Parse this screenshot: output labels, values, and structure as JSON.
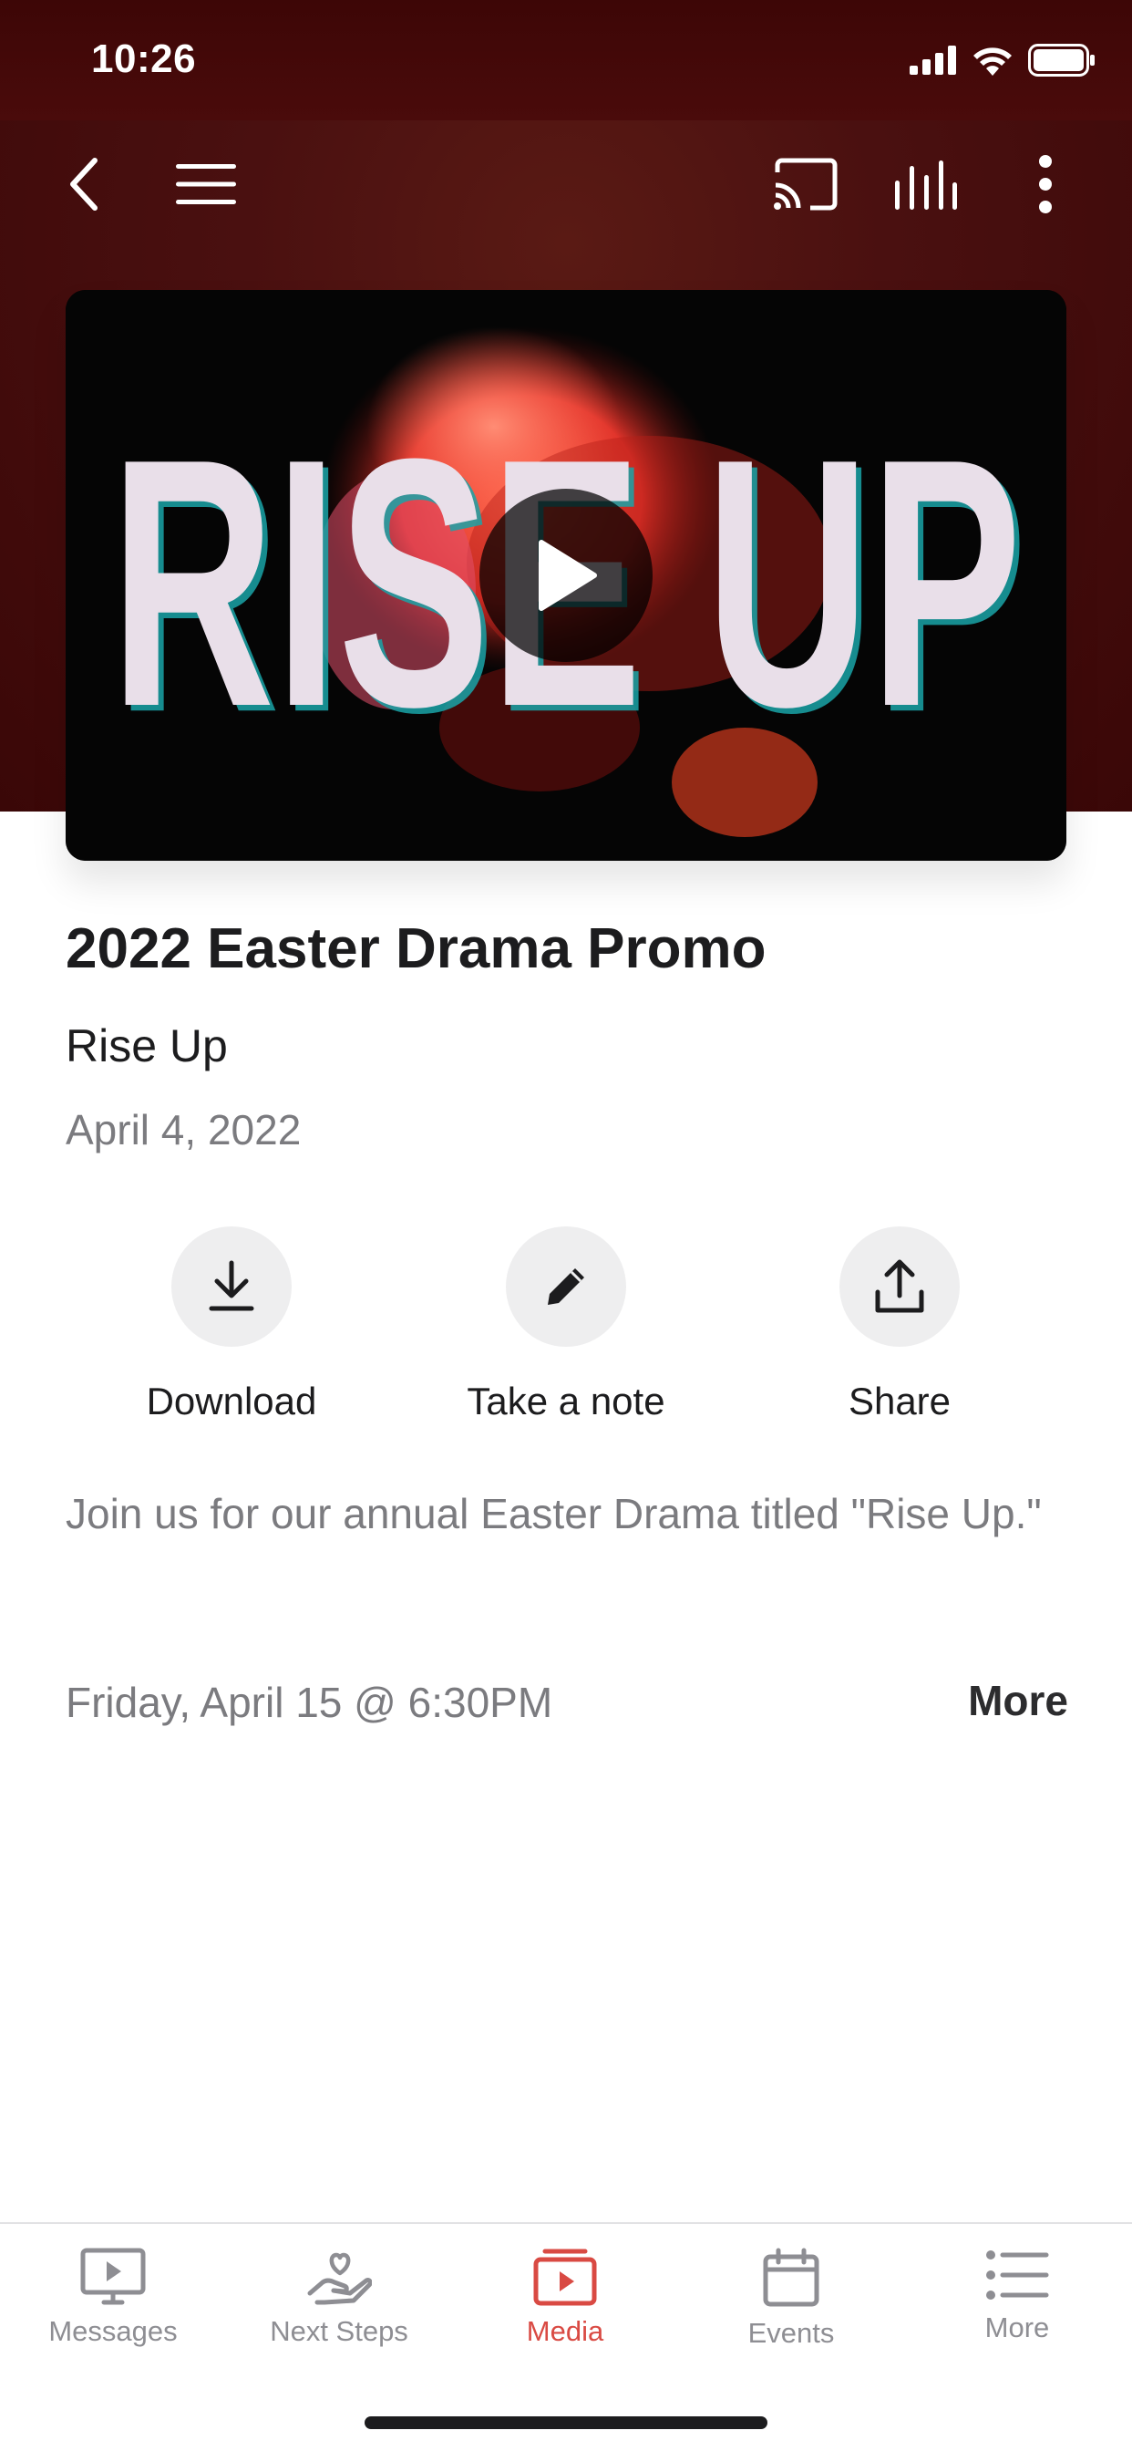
{
  "status_bar": {
    "time": "10:26"
  },
  "nav": {
    "icons": [
      "back-icon",
      "menu-icon",
      "cast-icon",
      "audio-levels-icon",
      "more-vertical-icon"
    ]
  },
  "video": {
    "thumbnail_text": "RISE UP",
    "play_icon": "play-icon"
  },
  "media": {
    "title": "2022 Easter Drama Promo",
    "subtitle": "Rise Up",
    "date": "April 4, 2022"
  },
  "actions": [
    {
      "label": "Download",
      "icon": "download-icon"
    },
    {
      "label": "Take a note",
      "icon": "pencil-icon"
    },
    {
      "label": "Share",
      "icon": "share-icon"
    }
  ],
  "description": "Join us for our annual Easter Drama titled \"Rise Up.\"",
  "event": {
    "time": "Friday, April 15 @ 6:30PM",
    "more_label": "More"
  },
  "tabs": [
    {
      "label": "Messages",
      "icon": "tv-play-icon",
      "active": false
    },
    {
      "label": "Next Steps",
      "icon": "hand-heart-icon",
      "active": false
    },
    {
      "label": "Media",
      "icon": "media-play-icon",
      "active": true
    },
    {
      "label": "Events",
      "icon": "calendar-icon",
      "active": false
    },
    {
      "label": "More",
      "icon": "list-icon",
      "active": false
    }
  ],
  "colors": {
    "accent": "#d94a43",
    "header_bg": "#4a0b0b",
    "tab_inactive": "#8e8e93"
  }
}
